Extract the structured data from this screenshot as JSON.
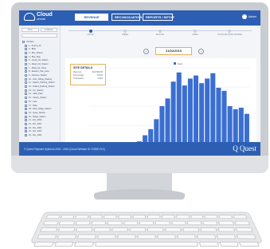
{
  "app": {
    "logo_name": "Cloud",
    "logo_sub": "central",
    "brand": "Q Quest"
  },
  "nav": {
    "tabs": [
      {
        "label": "REVENUE",
        "active": true
      },
      {
        "label": "RECONCILIATION",
        "active": false
      },
      {
        "label": "REPORTS / SETUP",
        "active": false
      }
    ],
    "user_label": "Admin"
  },
  "sidebar": {
    "buttons": [
      "View",
      "Collapse"
    ],
    "items": [
      "All Sites",
      "1 - Aurora_01",
      "2 - Bluff",
      "3 - Brix_Station",
      "4 - Bus_Stop",
      "5 - Coast_01_Station",
      "6 - Depot_01_Station",
      "7 - Delta_01_Trans",
      "8 - Eastern_Site_Area",
      "9 - Fairview_Station",
      "10 - Glen_Ridge_Parking",
      "11 - Harbor_Parking_Station",
      "12 - Hollow_Parking_Station",
      "13 - Inn_Station",
      "14 - Jade_Park",
      "15 - Kelsey_Station",
      "16 - Lark",
      "17 - Main",
      "18 - Park_Ridge_Station",
      "19 - Quay_Station",
      "20 - Ridge_Station",
      "21 - Rio_2000",
      "22 - Rio_2001",
      "23 - Rio_2002",
      "24 - Rio_2003",
      "25 - Rio_2004"
    ]
  },
  "timeline": {
    "labels": [
      "HOUR",
      "WEEK",
      "MONTH",
      "YEAR",
      "CUSTOM DATE RANGE"
    ],
    "active_index": 0
  },
  "date_nav": {
    "prev": "‹",
    "next": "›",
    "current": "21/02/2015"
  },
  "site_details": {
    "title": "SITE DETAILS",
    "rows": [
      {
        "label": "Revenue",
        "value": "$43,563.50"
      },
      {
        "label": "Percentage",
        "value": "23.5%"
      },
      {
        "label": "Transaction",
        "value": "2,054"
      }
    ]
  },
  "footer": {
    "copyright": "© Quest Payment Systems 2015 - 2016 (Cloud Website ID: 57895 XXX)"
  },
  "chart_data": {
    "type": "bar",
    "legend": "Sum",
    "color": "#3a6ed1",
    "values": [
      4,
      12,
      20,
      33,
      50,
      60,
      82,
      94,
      77,
      86,
      90,
      80,
      86,
      93,
      74,
      70,
      50,
      46,
      48,
      40
    ],
    "ylim": [
      0,
      100
    ]
  }
}
